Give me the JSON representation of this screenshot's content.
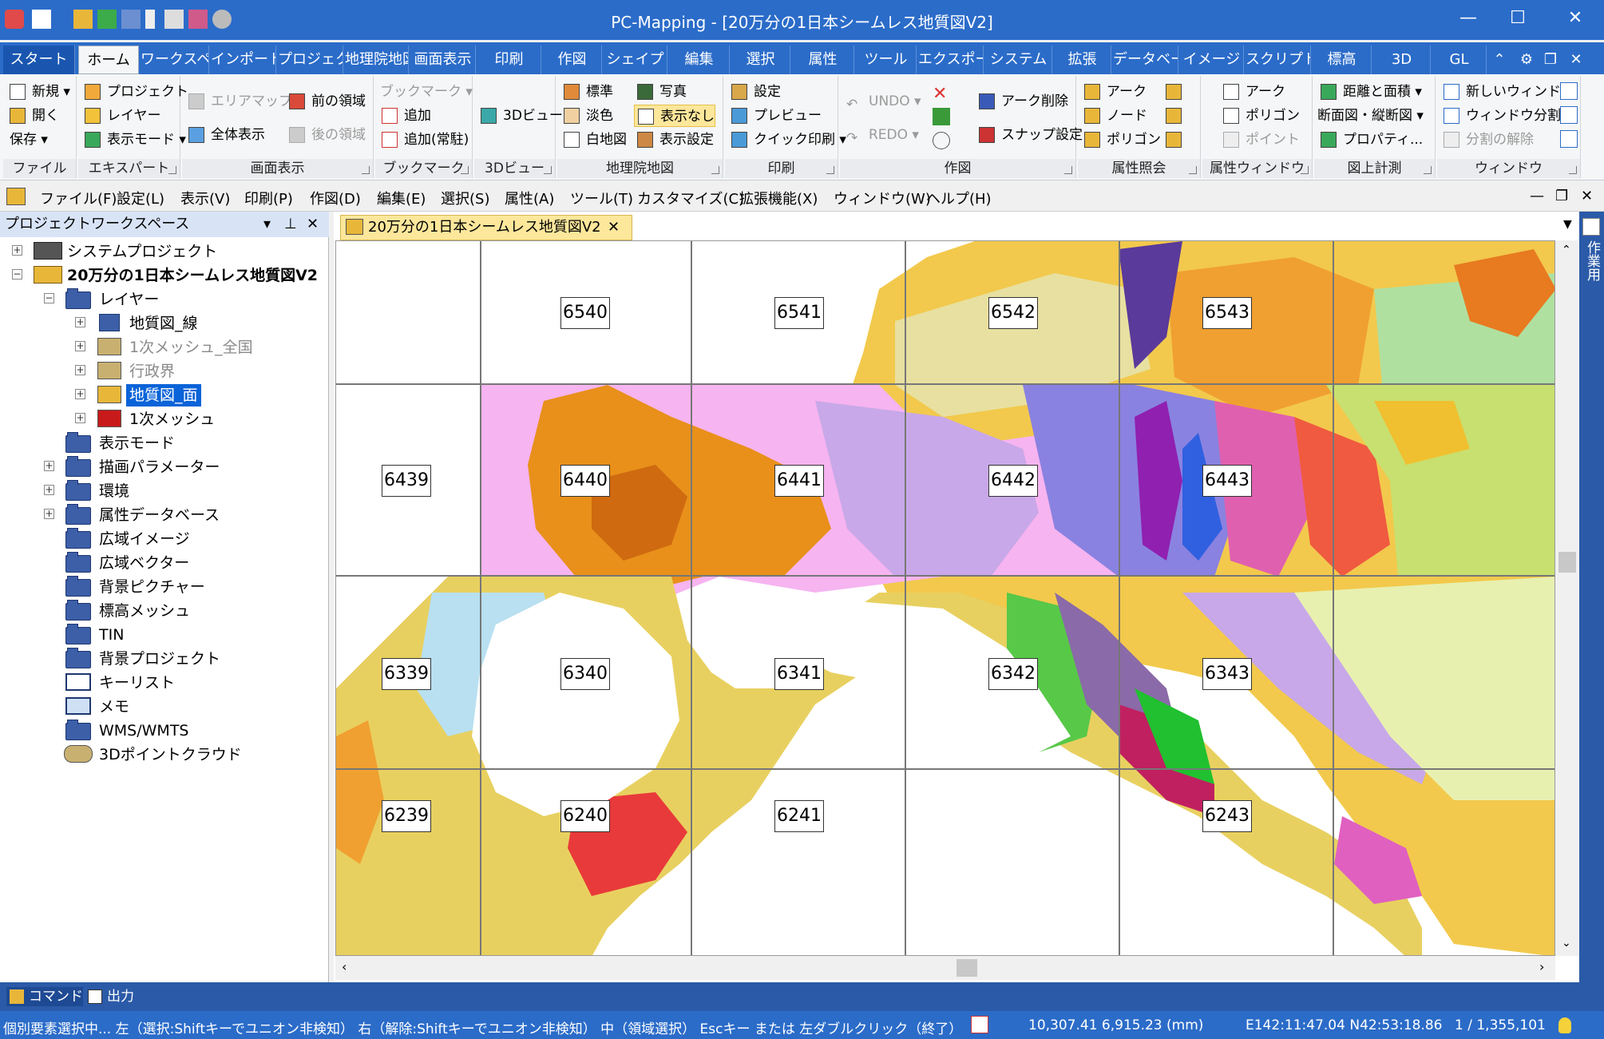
{
  "window": {
    "title": "PC-Mapping - [20万分の1日本シームレス地質図V2]"
  },
  "ribbon_tabs": [
    "スタート",
    "ホーム",
    "ワークスペース",
    "インポート",
    "プロジェクト",
    "地理院地図",
    "画面表示",
    "印刷",
    "作図",
    "シェイプ",
    "編集",
    "選択",
    "属性",
    "ツール",
    "エクスポート",
    "システム",
    "拡張",
    "データベース",
    "イメージ",
    "スクリプト",
    "標高",
    "3D",
    "GL"
  ],
  "ribbon": {
    "file": {
      "label": "ファイル",
      "new": "新規",
      "open": "開く",
      "save": "保存"
    },
    "expert": {
      "label": "エキスパート",
      "project": "プロジェクト",
      "layer": "レイヤー",
      "display_mode": "表示モード"
    },
    "view": {
      "label": "画面表示",
      "area_map": "エリアマップ",
      "show_all": "全体表示",
      "prev_area": "前の領域",
      "next_area": "後の領域"
    },
    "bookmark": {
      "label": "ブックマーク",
      "bookmark": "ブックマーク",
      "add": "追加",
      "add_resident": "追加(常駐)"
    },
    "view3d": {
      "label": "3Dビュー",
      "btn": "3Dビュー"
    },
    "gsi": {
      "label": "地理院地図",
      "standard": "標準",
      "pale": "淡色",
      "blank": "白地図",
      "photo": "写真",
      "none": "表示なし",
      "settings": "表示設定"
    },
    "print": {
      "label": "印刷",
      "setup": "設定",
      "preview": "プレビュー",
      "quick": "クイック印刷"
    },
    "draw": {
      "label": "作図",
      "undo": "UNDO",
      "redo": "REDO",
      "arc_delete": "アーク削除",
      "snap": "スナップ設定"
    },
    "attr_query": {
      "label": "属性照会",
      "arc": "アーク",
      "node": "ノード",
      "polygon": "ポリゴン"
    },
    "attr_window": {
      "label": "属性ウィンドウ",
      "arc": "アーク",
      "polygon": "ポリゴン",
      "point": "ポイント"
    },
    "measure": {
      "label": "図上計測",
      "dist_area": "距離と面積",
      "section": "断面図・縦断図",
      "property": "プロパティ..."
    },
    "window": {
      "label": "ウィンドウ",
      "new_window": "新しいウィンドウ",
      "split": "ウィンドウ分割",
      "unsplit": "分割の解除"
    }
  },
  "menu": [
    "ファイル(F)",
    "設定(L)",
    "表示(V)",
    "印刷(P)",
    "作図(D)",
    "編集(E)",
    "選択(S)",
    "属性(A)",
    "ツール(T)",
    "カスタマイズ(C)",
    "拡張機能(X)",
    "ウィンドウ(W)",
    "ヘルプ(H)"
  ],
  "workspace": {
    "title": "プロジェクトワークスペース",
    "system_project": "システムプロジェクト",
    "project": "20万分の1日本シームレス地質図V2",
    "layers_folder": "レイヤー",
    "layers": [
      "地質図_線",
      "1次メッシュ_全国",
      "行政界",
      "地質図_面",
      "1次メッシュ"
    ],
    "folders": [
      "表示モード",
      "描画パラメーター",
      "環境",
      "属性データベース",
      "広域イメージ",
      "広域ベクター",
      "背景ピクチャー",
      "標高メッシュ",
      "TIN",
      "背景プロジェクト",
      "キーリスト",
      "メモ",
      "WMS/WMTS",
      "3Dポイントクラウド"
    ]
  },
  "document_tab": "20万分の1日本シームレス地質図V2",
  "right_strip": "作業用",
  "mesh_labels": [
    "6540",
    "6541",
    "6542",
    "6543",
    "6439",
    "6440",
    "6441",
    "6442",
    "6443",
    "6339",
    "6340",
    "6341",
    "6342",
    "6343",
    "6239",
    "6240",
    "6241",
    "6243"
  ],
  "bottom_tabs": {
    "command": "コマンド",
    "output": "出力"
  },
  "status": {
    "message": "個別要素選択中... 左（選択:Shiftキーでユニオン非検知） 右（解除:Shiftキーでユニオン非検知） 中（領域選択） Escキー または 左ダブルクリック（終了）",
    "coords": "10,307.41 6,915.23 (mm)",
    "latlon": "E142:11:47.04 N42:53:18.86",
    "scale": "1 / 1,355,101"
  },
  "colors": {
    "accent": "#2b6cc9",
    "selected": "#0a63d8",
    "highlight": "#fde79b"
  }
}
